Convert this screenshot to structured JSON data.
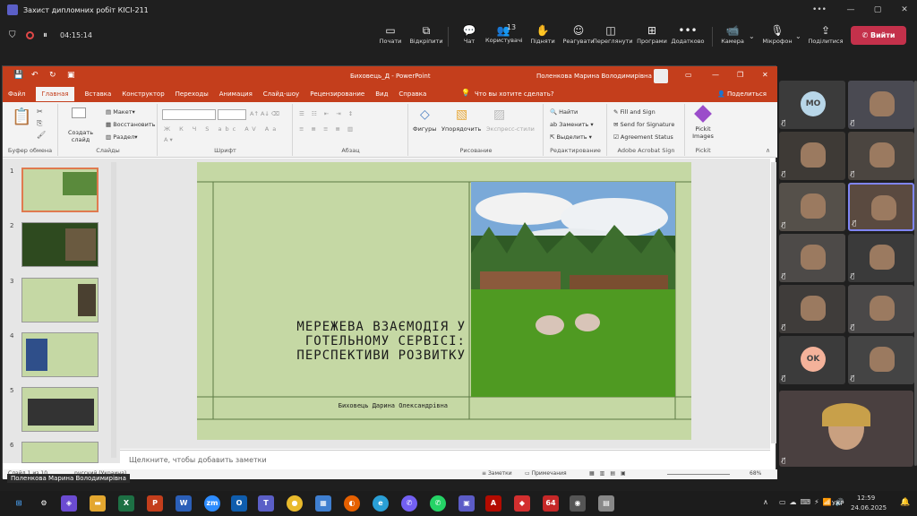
{
  "window": {
    "title": "Захист дипломних робіт КІСІ-211"
  },
  "meeting": {
    "timer": "04:15:14",
    "tools": [
      {
        "label": "Почати",
        "icon": "▭"
      },
      {
        "label": "Відкріпити",
        "icon": "⧉"
      },
      {
        "label": "Чат",
        "icon": "💬"
      },
      {
        "label": "Користувачі",
        "icon": "👥",
        "badge": "13"
      },
      {
        "label": "Підняти",
        "icon": "✋"
      },
      {
        "label": "Реагувати",
        "icon": "☺"
      },
      {
        "label": "Переглянути",
        "icon": "◫"
      },
      {
        "label": "Програми",
        "icon": "⊞"
      },
      {
        "label": "Додатково",
        "icon": "•••"
      }
    ],
    "camera": "Камера",
    "mic": "Мікрофон",
    "share": "Поділитися",
    "leave": "Вийти"
  },
  "ppt": {
    "doc_title": "Биховець_Д  -  PowerPoint",
    "user": "Поленкова Марина Володимирівна",
    "tabs": [
      "Файл",
      "Главная",
      "Вставка",
      "Конструктор",
      "Переходы",
      "Анимация",
      "Слайд-шоу",
      "Рецензирование",
      "Вид",
      "Справка"
    ],
    "tell_me": "Что вы хотите сделать?",
    "share": "Поделиться",
    "groups": {
      "clipboard": "Буфер обмена",
      "slides": "Слайды",
      "font": "Шрифт",
      "paragraph": "Абзац",
      "drawing": "Рисование",
      "editing": "Редактирование",
      "acrobat": "Adobe Acrobat Sign",
      "pickit": "Pickit"
    },
    "ribbon": {
      "paste": "Вставить",
      "create_slide": "Создать слайд",
      "layout": "Макет",
      "restore": "Восстановить",
      "section": "Раздел",
      "shapes": "Фигуры",
      "arrange": "Упорядочить",
      "express_styles": "Экспресс-стили",
      "find": "Найти",
      "replace": "Заменить",
      "select": "Выделить",
      "fill_sign": "Fill and Sign",
      "send_sig": "Send for Signature",
      "agreement": "Agreement Status",
      "pickit_images": "Pickit Images"
    },
    "thumbs": [
      "1",
      "2",
      "3",
      "4",
      "5",
      "6"
    ],
    "slide": {
      "title": "МЕРЕЖЕВА ВЗАЄМОДІЯ У ГОТЕЛЬНОМУ СЕРВІСІ: ПЕРСПЕКТИВИ РОЗВИТКУ",
      "author": "Биховець Дарина Олександрівна"
    },
    "notes_placeholder": "Щелкните, чтобы добавить заметки",
    "status": {
      "slide": "Слайд 1 из 10",
      "lang": "русский (Украина)",
      "notes": "Заметки",
      "comments": "Примечания",
      "zoom": "68%"
    }
  },
  "presenter_caption": "Поленкова Марина Володимирівна",
  "participants": [
    {
      "initials": "МО",
      "color": "#b8d6e8"
    },
    {
      "initials": ""
    },
    {
      "initials": ""
    },
    {
      "initials": ""
    },
    {
      "initials": ""
    },
    {
      "initials": ""
    },
    {
      "initials": ""
    },
    {
      "initials": ""
    },
    {
      "initials": ""
    },
    {
      "initials": ""
    },
    {
      "initials": "OK",
      "color": "#f4b29a"
    },
    {
      "initials": ""
    }
  ],
  "taskbar": {
    "lang": "УКР",
    "time": "12:59",
    "date": "24.06.2025"
  }
}
